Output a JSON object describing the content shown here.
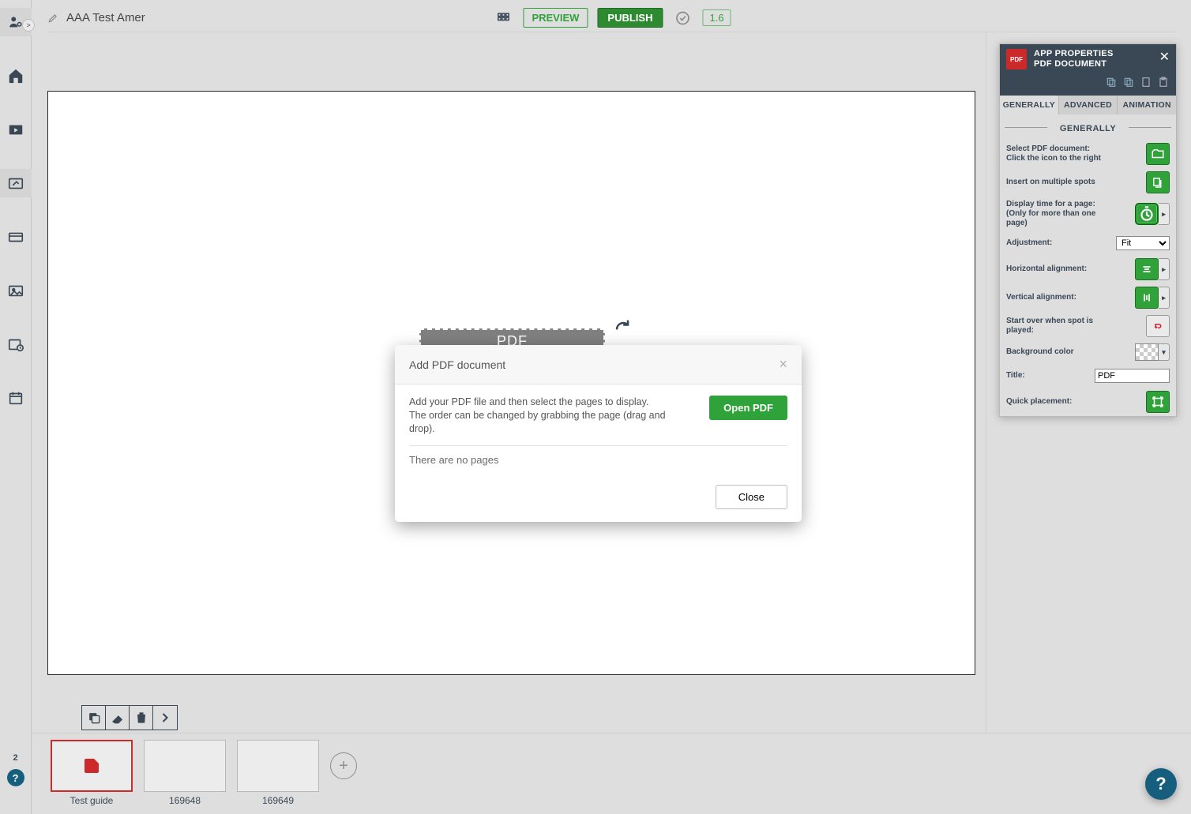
{
  "topbar": {
    "title": "AAA Test Amer",
    "preview": "PREVIEW",
    "publish": "PUBLISH",
    "version": "1.6"
  },
  "sidebar": {
    "badge": "2"
  },
  "canvas": {
    "pdf_placeholder": "PDF"
  },
  "spots": {
    "items": [
      {
        "label": "Test guide",
        "active": true,
        "has_pdf": true
      },
      {
        "label": "169648",
        "active": false,
        "has_pdf": false
      },
      {
        "label": "169649",
        "active": false,
        "has_pdf": false
      }
    ]
  },
  "panel": {
    "header_line1": "APP PROPERTIES",
    "header_line2": "PDF DOCUMENT",
    "tabs": {
      "general": "GENERALLY",
      "advanced": "ADVANCED",
      "animation": "ANIMATION"
    },
    "section": "GENERALLY",
    "rows": {
      "select_pdf_l1": "Select PDF document:",
      "select_pdf_l2": "Click the icon to the right",
      "multi": "Insert on multiple spots",
      "display_l1": "Display time for a page:",
      "display_l2": "(Only for more than one page)",
      "adjustment": "Adjustment:",
      "adjustment_value": "Fit",
      "halign": "Horizontal alignment:",
      "valign": "Vertical alignment:",
      "startover": "Start over when spot is played:",
      "bgcolor": "Background color",
      "title": "Title:",
      "title_value": "PDF",
      "quick": "Quick placement:"
    }
  },
  "modal": {
    "title": "Add PDF document",
    "desc_l1": "Add your PDF file and then select the pages to display.",
    "desc_l2": "The order can be changed by grabbing the page (drag and drop).",
    "open": "Open PDF",
    "empty": "There are no pages",
    "close": "Close"
  }
}
